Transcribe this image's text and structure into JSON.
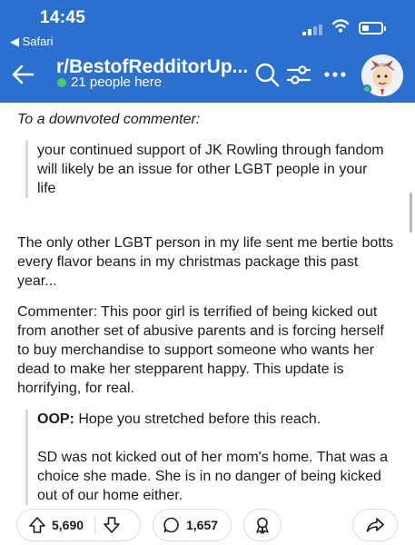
{
  "status_bar": {
    "time": "14:45",
    "back_app": "◀ Safari"
  },
  "header": {
    "subreddit": "r/BestofRedditorUp...",
    "online_text": "21 people here",
    "icons": [
      "back-arrow-icon",
      "search-icon",
      "filter-icon",
      "more-icon",
      "avatar"
    ],
    "colors": {
      "header_bg": "#2b70cf",
      "online": "#49c96a"
    }
  },
  "post": {
    "intro": "To a downvoted commenter:",
    "quote_1": "your continued support of JK Rowling through fandom will likely be an issue for other LGBT people in your life",
    "para_1": "The only other LGBT person in my life sent me bertie botts every flavor beans in my christmas package this past year...",
    "para_2": "Commenter: This poor girl is terrified of being kicked out from another set of abusive parents and is forcing herself to buy merchandise to support someone who wants her dead to make her stepparent happy. This update is horrifying, for real.",
    "quote_2": {
      "label": "OOP:",
      "line_1": " Hope you stretched before this reach.",
      "line_2": "SD was not kicked out of her mom's home. That was a choice she made. She is in no danger of being kicked out of our home either."
    }
  },
  "actions": {
    "votes": "5,690",
    "comments": "1,657"
  }
}
